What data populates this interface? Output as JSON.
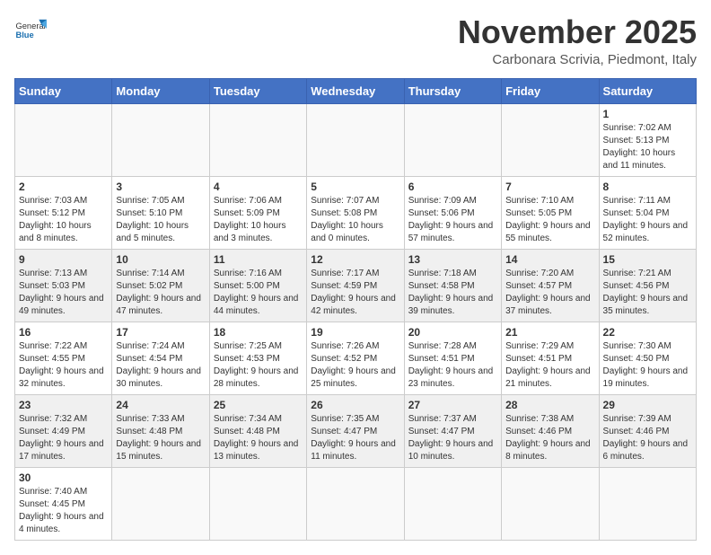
{
  "header": {
    "logo_general": "General",
    "logo_blue": "Blue",
    "title": "November 2025",
    "subtitle": "Carbonara Scrivia, Piedmont, Italy"
  },
  "days_of_week": [
    "Sunday",
    "Monday",
    "Tuesday",
    "Wednesday",
    "Thursday",
    "Friday",
    "Saturday"
  ],
  "weeks": [
    [
      {
        "day": "",
        "info": ""
      },
      {
        "day": "",
        "info": ""
      },
      {
        "day": "",
        "info": ""
      },
      {
        "day": "",
        "info": ""
      },
      {
        "day": "",
        "info": ""
      },
      {
        "day": "",
        "info": ""
      },
      {
        "day": "1",
        "info": "Sunrise: 7:02 AM\nSunset: 5:13 PM\nDaylight: 10 hours and 11 minutes."
      }
    ],
    [
      {
        "day": "2",
        "info": "Sunrise: 7:03 AM\nSunset: 5:12 PM\nDaylight: 10 hours and 8 minutes."
      },
      {
        "day": "3",
        "info": "Sunrise: 7:05 AM\nSunset: 5:10 PM\nDaylight: 10 hours and 5 minutes."
      },
      {
        "day": "4",
        "info": "Sunrise: 7:06 AM\nSunset: 5:09 PM\nDaylight: 10 hours and 3 minutes."
      },
      {
        "day": "5",
        "info": "Sunrise: 7:07 AM\nSunset: 5:08 PM\nDaylight: 10 hours and 0 minutes."
      },
      {
        "day": "6",
        "info": "Sunrise: 7:09 AM\nSunset: 5:06 PM\nDaylight: 9 hours and 57 minutes."
      },
      {
        "day": "7",
        "info": "Sunrise: 7:10 AM\nSunset: 5:05 PM\nDaylight: 9 hours and 55 minutes."
      },
      {
        "day": "8",
        "info": "Sunrise: 7:11 AM\nSunset: 5:04 PM\nDaylight: 9 hours and 52 minutes."
      }
    ],
    [
      {
        "day": "9",
        "info": "Sunrise: 7:13 AM\nSunset: 5:03 PM\nDaylight: 9 hours and 49 minutes."
      },
      {
        "day": "10",
        "info": "Sunrise: 7:14 AM\nSunset: 5:02 PM\nDaylight: 9 hours and 47 minutes."
      },
      {
        "day": "11",
        "info": "Sunrise: 7:16 AM\nSunset: 5:00 PM\nDaylight: 9 hours and 44 minutes."
      },
      {
        "day": "12",
        "info": "Sunrise: 7:17 AM\nSunset: 4:59 PM\nDaylight: 9 hours and 42 minutes."
      },
      {
        "day": "13",
        "info": "Sunrise: 7:18 AM\nSunset: 4:58 PM\nDaylight: 9 hours and 39 minutes."
      },
      {
        "day": "14",
        "info": "Sunrise: 7:20 AM\nSunset: 4:57 PM\nDaylight: 9 hours and 37 minutes."
      },
      {
        "day": "15",
        "info": "Sunrise: 7:21 AM\nSunset: 4:56 PM\nDaylight: 9 hours and 35 minutes."
      }
    ],
    [
      {
        "day": "16",
        "info": "Sunrise: 7:22 AM\nSunset: 4:55 PM\nDaylight: 9 hours and 32 minutes."
      },
      {
        "day": "17",
        "info": "Sunrise: 7:24 AM\nSunset: 4:54 PM\nDaylight: 9 hours and 30 minutes."
      },
      {
        "day": "18",
        "info": "Sunrise: 7:25 AM\nSunset: 4:53 PM\nDaylight: 9 hours and 28 minutes."
      },
      {
        "day": "19",
        "info": "Sunrise: 7:26 AM\nSunset: 4:52 PM\nDaylight: 9 hours and 25 minutes."
      },
      {
        "day": "20",
        "info": "Sunrise: 7:28 AM\nSunset: 4:51 PM\nDaylight: 9 hours and 23 minutes."
      },
      {
        "day": "21",
        "info": "Sunrise: 7:29 AM\nSunset: 4:51 PM\nDaylight: 9 hours and 21 minutes."
      },
      {
        "day": "22",
        "info": "Sunrise: 7:30 AM\nSunset: 4:50 PM\nDaylight: 9 hours and 19 minutes."
      }
    ],
    [
      {
        "day": "23",
        "info": "Sunrise: 7:32 AM\nSunset: 4:49 PM\nDaylight: 9 hours and 17 minutes."
      },
      {
        "day": "24",
        "info": "Sunrise: 7:33 AM\nSunset: 4:48 PM\nDaylight: 9 hours and 15 minutes."
      },
      {
        "day": "25",
        "info": "Sunrise: 7:34 AM\nSunset: 4:48 PM\nDaylight: 9 hours and 13 minutes."
      },
      {
        "day": "26",
        "info": "Sunrise: 7:35 AM\nSunset: 4:47 PM\nDaylight: 9 hours and 11 minutes."
      },
      {
        "day": "27",
        "info": "Sunrise: 7:37 AM\nSunset: 4:47 PM\nDaylight: 9 hours and 10 minutes."
      },
      {
        "day": "28",
        "info": "Sunrise: 7:38 AM\nSunset: 4:46 PM\nDaylight: 9 hours and 8 minutes."
      },
      {
        "day": "29",
        "info": "Sunrise: 7:39 AM\nSunset: 4:46 PM\nDaylight: 9 hours and 6 minutes."
      }
    ],
    [
      {
        "day": "30",
        "info": "Sunrise: 7:40 AM\nSunset: 4:45 PM\nDaylight: 9 hours and 4 minutes."
      },
      {
        "day": "",
        "info": ""
      },
      {
        "day": "",
        "info": ""
      },
      {
        "day": "",
        "info": ""
      },
      {
        "day": "",
        "info": ""
      },
      {
        "day": "",
        "info": ""
      },
      {
        "day": "",
        "info": ""
      }
    ]
  ],
  "colors": {
    "header_bg": "#4472c4",
    "header_text": "#ffffff",
    "border": "#cccccc",
    "shaded_row": "#f0f0f0"
  }
}
